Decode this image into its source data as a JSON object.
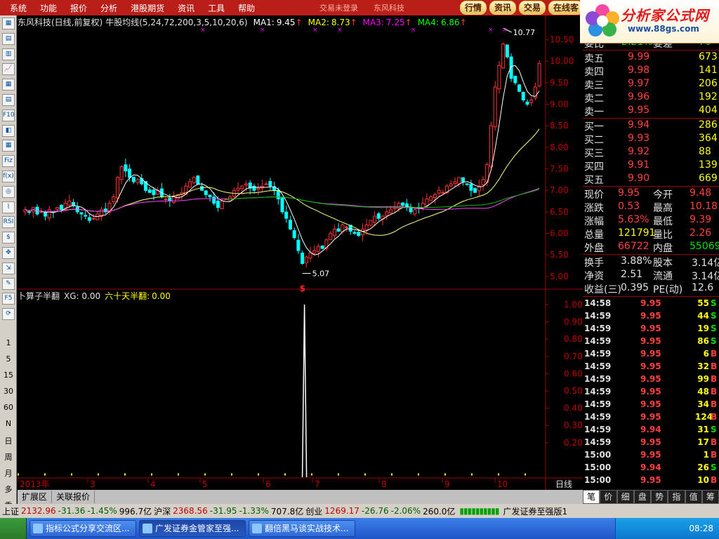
{
  "menu": {
    "items": [
      "系统",
      "功能",
      "报价",
      "分析",
      "港股期货",
      "资讯",
      "工具",
      "帮助"
    ],
    "middle": [
      "交易未登录",
      "东风科技"
    ]
  },
  "tabs": [
    "行情",
    "资讯",
    "交易",
    "在线客"
  ],
  "logo": {
    "title": "分析家公式网",
    "url": "www.88gs.com"
  },
  "sidebar": {
    "buttons": [
      "▦",
      "▤",
      "▥",
      "📈",
      "▦",
      "▤",
      "F10",
      "◧",
      "▦",
      "Fiz",
      "f(x)",
      "◎",
      "⌇",
      "RSI",
      "$",
      "✥",
      "⇲",
      "✎",
      "F5",
      "⟳"
    ],
    "periods": [
      "1",
      "5",
      "15",
      "30",
      "60",
      "N",
      "日",
      "周",
      "月",
      "多",
      "季"
    ]
  },
  "chart": {
    "header": {
      "name": "东风科技(日线,前复权)",
      "indicator": "牛股均线(5,24,72,200,3,5,10,20,6)",
      "ma": [
        {
          "label": "MA1:",
          "value": "9.45",
          "arrow": "↑",
          "color": "#ffffff"
        },
        {
          "label": "MA2:",
          "value": "8.73",
          "arrow": "↑",
          "color": "#ffff00"
        },
        {
          "label": "MA3:",
          "value": "7.25",
          "arrow": "↑",
          "color": "#ff00ff"
        },
        {
          "label": "MA4:",
          "value": "6.86",
          "arrow": "↑",
          "color": "#00ff00"
        }
      ]
    },
    "price_axis": [
      "10.50",
      "10.00",
      "9.50",
      "9.00",
      "8.50",
      "8.00",
      "7.50",
      "7.00",
      "6.50",
      "6.00",
      "5.50",
      "5.00"
    ],
    "high_label": "10.77",
    "low_label": "5.07",
    "sub_header": {
      "name": "卜算子半翻",
      "xg": "XG: 0.00",
      "rule": "六十天半翻:",
      "rule_value": "0.00"
    },
    "sub_axis": [
      "1.00",
      "0.90",
      "0.80",
      "0.70",
      "0.60",
      "0.50",
      "0.40",
      "0.30",
      "0.20"
    ],
    "date_axis": [
      "2013年",
      "3",
      "4",
      "5",
      "6",
      "7",
      "8",
      "9",
      "10"
    ],
    "period": "日线"
  },
  "chart_data": {
    "type": "candlestick",
    "title": "东风科技(日线,前复权)",
    "ylim": [
      4.9,
      10.77
    ],
    "high": 10.77,
    "low": 5.07,
    "ma_values": {
      "MA1": 9.45,
      "MA2": 8.73,
      "MA3": 7.25,
      "MA4": 6.86
    },
    "closes": [
      6.55,
      6.5,
      6.6,
      6.45,
      6.5,
      6.4,
      6.55,
      6.5,
      6.6,
      6.55,
      6.7,
      6.75,
      6.65,
      6.5,
      6.45,
      6.4,
      6.3,
      6.35,
      6.45,
      6.55,
      6.5,
      6.7,
      6.85,
      7.3,
      7.55,
      7.45,
      7.3,
      7.2,
      7.25,
      7.15,
      7.0,
      6.95,
      6.9,
      7.0,
      6.85,
      6.8,
      6.75,
      6.85,
      6.9,
      6.95,
      7.1,
      7.2,
      7.3,
      7.15,
      7.0,
      6.9,
      6.85,
      6.7,
      6.6,
      6.75,
      6.8,
      6.85,
      7.0,
      7.05,
      7.1,
      7.15,
      7.05,
      7.0,
      7.05,
      7.1,
      7.15,
      7.1,
      7.0,
      6.8,
      6.5,
      6.35,
      6.1,
      5.9,
      5.6,
      5.3,
      5.45,
      5.55,
      5.6,
      5.7,
      5.65,
      5.85,
      6.0,
      6.1,
      6.05,
      6.2,
      6.15,
      6.05,
      6.0,
      5.95,
      6.1,
      6.2,
      6.3,
      6.4,
      6.35,
      6.4,
      6.5,
      6.55,
      6.6,
      6.7,
      6.65,
      6.6,
      6.5,
      6.55,
      6.6,
      6.7,
      6.8,
      6.85,
      6.9,
      7.0,
      6.95,
      7.1,
      7.15,
      7.2,
      7.3,
      7.2,
      7.15,
      7.0,
      6.95,
      7.1,
      7.25,
      7.6,
      8.5,
      9.4,
      9.9,
      10.4,
      10.1,
      9.6,
      9.5,
      9.3,
      9.1,
      9.0,
      9.1,
      9.4,
      9.95
    ],
    "sub_indicator": {
      "name": "六十天半翻",
      "current": 0.0,
      "signal_value": 1.0,
      "ylim": [
        0,
        1.0
      ]
    },
    "x_axis": [
      "2013年",
      "3",
      "4",
      "5",
      "6",
      "7",
      "8",
      "9",
      "10"
    ]
  },
  "quote": {
    "diff_row": {
      "label": "委比",
      "value": "-2.21%",
      "label2": "委差",
      "value2": "-70"
    },
    "sells": [
      {
        "label": "卖五",
        "price": "9.99",
        "vol": "673"
      },
      {
        "label": "卖四",
        "price": "9.98",
        "vol": "141"
      },
      {
        "label": "卖三",
        "price": "9.97",
        "vol": "206"
      },
      {
        "label": "卖二",
        "price": "9.96",
        "vol": "192"
      },
      {
        "label": "卖一",
        "price": "9.95",
        "vol": "404"
      }
    ],
    "buys": [
      {
        "label": "买一",
        "price": "9.94",
        "vol": "286"
      },
      {
        "label": "买二",
        "price": "9.93",
        "vol": "364"
      },
      {
        "label": "买三",
        "price": "9.92",
        "vol": "88"
      },
      {
        "label": "买四",
        "price": "9.91",
        "vol": "139"
      },
      {
        "label": "买五",
        "price": "9.90",
        "vol": "669"
      }
    ],
    "stats": [
      {
        "l1": "现价",
        "v1": "9.95",
        "l2": "今开",
        "v2": "9.48",
        "c1": "red",
        "c2": "red"
      },
      {
        "l1": "涨跌",
        "v1": "0.53",
        "l2": "最高",
        "v2": "10.18",
        "c1": "red",
        "c2": "red"
      },
      {
        "l1": "涨幅",
        "v1": "5.63%",
        "l2": "最低",
        "v2": "9.39",
        "c1": "red",
        "c2": "red"
      },
      {
        "l1": "总量",
        "v1": "121791",
        "l2": "量比",
        "v2": "2.26",
        "c1": "yel",
        "c2": "red"
      },
      {
        "l1": "外盘",
        "v1": "66722",
        "l2": "内盘",
        "v2": "55069",
        "c1": "red",
        "c2": "green"
      }
    ],
    "stats2": [
      {
        "l1": "换手",
        "v1": "3.88%",
        "l2": "股本",
        "v2": "3.14亿"
      },
      {
        "l1": "净资",
        "v1": "2.51",
        "l2": "流通",
        "v2": "3.14亿"
      },
      {
        "l1": "收益(三)",
        "v1": "0.395",
        "l2": "PE(动)",
        "v2": "12.6"
      }
    ]
  },
  "ticks": [
    {
      "t": "14:58",
      "p": "9.95",
      "v": "55",
      "d": "S"
    },
    {
      "t": "14:59",
      "p": "9.95",
      "v": "44",
      "d": "S"
    },
    {
      "t": "14:59",
      "p": "9.95",
      "v": "19",
      "d": "S"
    },
    {
      "t": "14:59",
      "p": "9.95",
      "v": "86",
      "d": "S"
    },
    {
      "t": "14:59",
      "p": "9.95",
      "v": "6",
      "d": "B"
    },
    {
      "t": "14:59",
      "p": "9.95",
      "v": "32",
      "d": "B"
    },
    {
      "t": "14:59",
      "p": "9.95",
      "v": "99",
      "d": "B"
    },
    {
      "t": "14:59",
      "p": "9.95",
      "v": "48",
      "d": "B"
    },
    {
      "t": "14:59",
      "p": "9.95",
      "v": "34",
      "d": "B"
    },
    {
      "t": "14:59",
      "p": "9.95",
      "v": "124",
      "d": "B"
    },
    {
      "t": "14:59",
      "p": "9.94",
      "v": "31",
      "d": "S"
    },
    {
      "t": "14:59",
      "p": "9.95",
      "v": "17",
      "d": "B"
    },
    {
      "t": "15:00",
      "p": "9.95",
      "v": "1",
      "d": "B"
    },
    {
      "t": "15:00",
      "p": "9.94",
      "v": "26",
      "d": "S"
    },
    {
      "t": "15:00",
      "p": "9.95",
      "v": "10",
      "d": "B"
    }
  ],
  "subtabs": [
    "笔",
    "价",
    "细",
    "盘",
    "势",
    "指",
    "值",
    "筹"
  ],
  "bottomtabs": [
    "扩展区",
    "关联报价"
  ],
  "status": {
    "sh": {
      "label": "上证",
      "val": "2132.96",
      "chg": "-31.36",
      "pct": "-1.45%",
      "amt": "996.7亿"
    },
    "sz": {
      "label": "沪深",
      "val": "2368.56",
      "chg": "-31.95",
      "pct": "-1.33%",
      "amt": "707.8亿"
    },
    "cy": {
      "label": "创业",
      "val": "1269.17",
      "chg": "-26.76",
      "pct": "-2.06%",
      "amt": "260.0亿"
    },
    "broker": "广发证券至强版1"
  },
  "taskbar": {
    "tasks": [
      "指标公式分享交流区...",
      "广发证券金管家至强...",
      "翻倍黑马谈实战技术..."
    ],
    "clock": "08:28"
  }
}
